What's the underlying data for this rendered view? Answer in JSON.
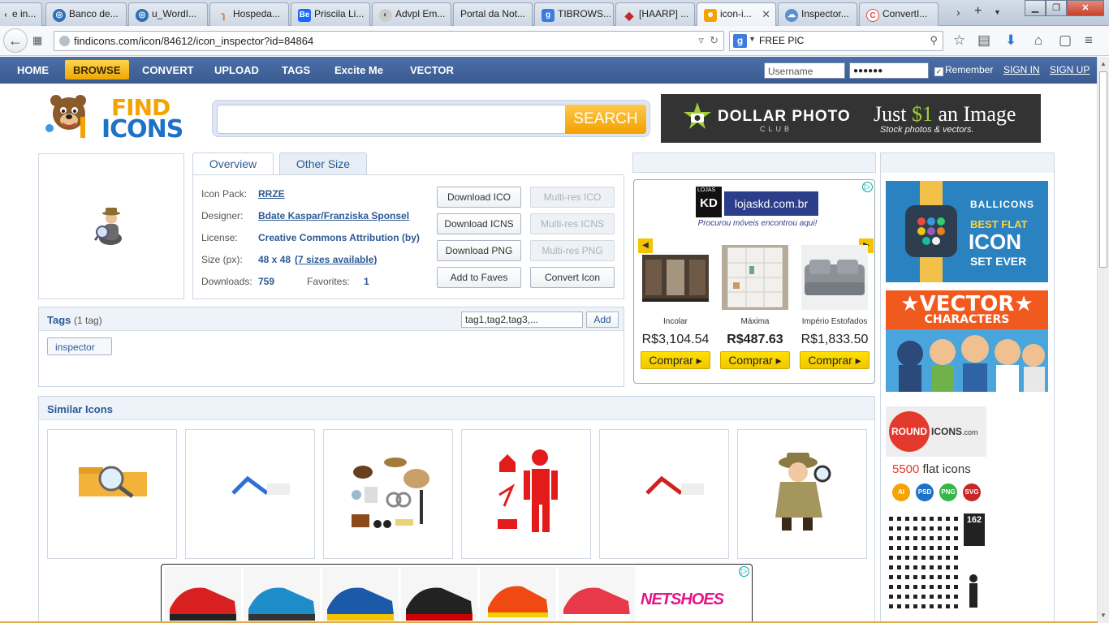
{
  "browser": {
    "tabs": [
      {
        "label": "e in...",
        "favicon": "arrow-icon",
        "color": "#888888"
      },
      {
        "label": "Banco de...",
        "favicon": "globe-icon",
        "color": "#2e6fb5"
      },
      {
        "label": "u_WordI...",
        "favicon": "globe-icon",
        "color": "#2e6fb5"
      },
      {
        "label": "Hospeda...",
        "favicon": "rss-icon",
        "color": "#e37a2c"
      },
      {
        "label": "Priscila Li...",
        "favicon": "behance-icon",
        "color": "#1769ff"
      },
      {
        "label": "Advpl Em...",
        "favicon": "page-icon",
        "color": "#999999"
      },
      {
        "label": "Portal da Not...",
        "favicon": "blank-icon",
        "color": "#dddddd"
      },
      {
        "label": "TIBROWS...",
        "favicon": "g-icon",
        "color": "#3c7be0"
      },
      {
        "label": "[HAARP] ...",
        "favicon": "haarp-icon",
        "color": "#c62828"
      },
      {
        "label": "icon-i...",
        "favicon": "findicons-icon",
        "color": "#f5a300",
        "active": true
      },
      {
        "label": "Inspector...",
        "favicon": "cloud-icon",
        "color": "#5a8fd0"
      },
      {
        "label": "ConvertI...",
        "favicon": "convert-icon",
        "color": "#e44"
      }
    ],
    "url": "findicons.com/icon/84612/icon_inspector?id=84864",
    "search_value": "FREE PIC",
    "search_engine": "g-icon"
  },
  "menu": {
    "items": [
      "HOME",
      "BROWSE",
      "CONVERT",
      "UPLOAD",
      "TAGS",
      "Excite Me",
      "VECTOR"
    ],
    "username_placeholder": "Username",
    "password_value": "●●●●●●",
    "remember": "Remember",
    "sign_in": "SIGN IN",
    "sign_up": "SIGN UP"
  },
  "header": {
    "logo_find": "FIND",
    "logo_icons": "ICONS",
    "search_button": "SEARCH",
    "search_placeholder": "",
    "banner_brand": "DOLLAR PHOTO",
    "banner_club": "CLUB",
    "banner_just": "Just",
    "banner_price": "$1",
    "banner_rest": "an Image",
    "banner_sub": "Stock photos & vectors."
  },
  "tabs": {
    "overview": "Overview",
    "other_size": "Other Size"
  },
  "details": {
    "icon_pack_label": "Icon Pack:",
    "icon_pack": "RRZE",
    "designer_label": "Designer:",
    "designer": "Bdate Kaspar/Franziska Sponsel",
    "license_label": "License:",
    "license": "Creative Commons Attribution (by)",
    "size_label": "Size (px):",
    "size": "48 x 48",
    "sizes_link": "(7 sizes available)",
    "downloads_label": "Downloads:",
    "downloads": "759",
    "favorites_label": "Favorites:",
    "favorites": "1"
  },
  "buttons": {
    "download_ico": "Download ICO",
    "download_icns": "Download ICNS",
    "download_png": "Download PNG",
    "add_faves": "Add to Faves",
    "multi_ico": "Multi-res ICO",
    "multi_icns": "Multi-res ICNS",
    "multi_png": "Multi-res PNG",
    "convert_icon": "Convert Icon"
  },
  "tags": {
    "title": "Tags",
    "count": "(1 tag)",
    "input_value": "tag1,tag2,tag3,...",
    "add": "Add",
    "items": [
      "inspector"
    ]
  },
  "ad_store": {
    "logo": "KD",
    "lojas": "LOJAS",
    "domain": "lojaskd.com.br",
    "tagline": "Procurou móveis encontrou aqui!",
    "products": [
      {
        "name": "Incolar",
        "price": "R$3,104.54",
        "cta": "Comprar ▸"
      },
      {
        "name": "Máxima",
        "price": "R$487.63",
        "cta": "Comprar ▸"
      },
      {
        "name": "Império Estofados",
        "price": "R$1,833.50",
        "cta": "Comprar ▸"
      }
    ]
  },
  "similar": {
    "title": "Similar Icons",
    "icons": [
      "folder-search-icon",
      "house-blue-icon",
      "detective-items-icon",
      "firefighter-icon",
      "house-red-icon",
      "detective-icon"
    ]
  },
  "ad_shoes": {
    "brand": "NETSHOES"
  },
  "right_ads": {
    "ballicons": {
      "title": "BALLICONS",
      "line1": "BEST FLAT",
      "line2": "ICON",
      "line3": "SET EVER"
    },
    "vector": {
      "line1": "★VECTOR★",
      "line2": "CHARACTERS"
    },
    "round": {
      "circle": "ROUND",
      "rest": "ICONS",
      "suffix": ".com"
    },
    "flat_count": "5500",
    "flat_text": "flat icons",
    "formats": [
      "AI",
      "PSD",
      "PNG",
      "SVG"
    ],
    "format_colors": [
      "#f5a300",
      "#1d72c8",
      "#38b54a",
      "#c62828"
    ],
    "glyph_badge": "162"
  }
}
